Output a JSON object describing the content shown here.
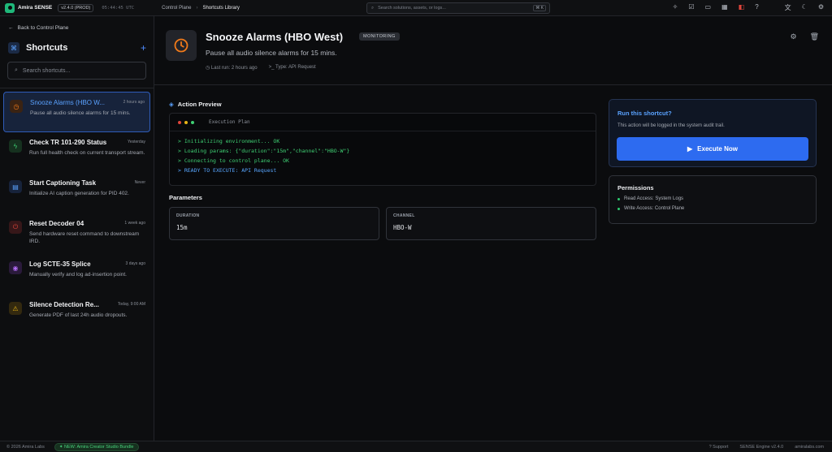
{
  "topbar": {
    "app_name": "Amira SENSE",
    "version": "v2.4.0 (PROD)",
    "clock": "05:44:45 UTC",
    "breadcrumb": [
      "Control Plane",
      "Shortcuts Library"
    ],
    "search_placeholder": "Search solutions, assets, or logs...",
    "search_shortcut": "⌘ K",
    "icons": [
      "sparkle-icon",
      "check-square-icon",
      "monitor-icon",
      "grid-icon",
      "alert-icon",
      "help-icon",
      "translate-icon",
      "theme-icon",
      "settings-icon"
    ]
  },
  "sidebar": {
    "back_label": "Back to Control Plane",
    "title": "Shortcuts",
    "search_placeholder": "Search shortcuts...",
    "items": [
      {
        "name": "Snooze Alarms (HBO W...",
        "when": "2 hours ago",
        "desc": "Pause all audio silence alarms for 15 mins.",
        "icon": "clock-icon",
        "color": "#f07a1a",
        "bg": "#3a2313"
      },
      {
        "name": "Check TR 101-290 Status",
        "when": "Yesterday",
        "desc": "Run full health check on current transport stream.",
        "icon": "bolt-icon",
        "color": "#3fcf73",
        "bg": "#16311f"
      },
      {
        "name": "Start Captioning Task",
        "when": "Never",
        "desc": "Initialize AI caption generation for PID 402.",
        "icon": "document-icon",
        "color": "#5aa2ff",
        "bg": "#17233b"
      },
      {
        "name": "Reset Decoder 04",
        "when": "1 week ago",
        "desc": "Send hardware reset command to downstream IRD.",
        "icon": "power-icon",
        "color": "#e0453b",
        "bg": "#361719"
      },
      {
        "name": "Log SCTE-35 Splice",
        "when": "3 days ago",
        "desc": "Manually verify and log ad-insertion point.",
        "icon": "broadcast-icon",
        "color": "#b36cf5",
        "bg": "#2a1a3b"
      },
      {
        "name": "Silence Detection Re...",
        "when": "Today, 9:00 AM",
        "desc": "Generate PDF of last 24h audio dropouts.",
        "icon": "warning-icon",
        "color": "#e7b416",
        "bg": "#33290f"
      }
    ]
  },
  "header": {
    "title": "Snooze Alarms (HBO West)",
    "badge": "MONITORING",
    "subtitle": "Pause all audio silence alarms for 15 mins.",
    "last_run": "Last run: 2 hours ago",
    "type": "Type: API Request"
  },
  "preview": {
    "label": "Action Preview",
    "terminal_title": "Execution Plan",
    "lines": [
      "> Initializing environment... OK",
      "> Loading params: {\"duration\":\"15m\",\"channel\":\"HBO-W\"}",
      "> Connecting to control plane... OK",
      "> READY TO EXECUTE: API Request"
    ]
  },
  "parameters": {
    "label": "Parameters",
    "fields": [
      {
        "label": "DURATION",
        "value": "15m"
      },
      {
        "label": "CHANNEL",
        "value": "HBO-W"
      }
    ]
  },
  "run_card": {
    "title": "Run this shortcut?",
    "note": "This action will be logged in the system audit trail.",
    "button": "Execute Now"
  },
  "permissions": {
    "title": "Permissions",
    "items": [
      "Read Access: System Logs",
      "Write Access: Control Plane"
    ]
  },
  "statusbar": {
    "copyright": "© 2026 Amira Labs",
    "new_badge": "NEW: Amira Creator Studio Bundle",
    "support": "Support",
    "engine": "SENSE Engine v2.4.0",
    "site": "amiralabs.com"
  }
}
